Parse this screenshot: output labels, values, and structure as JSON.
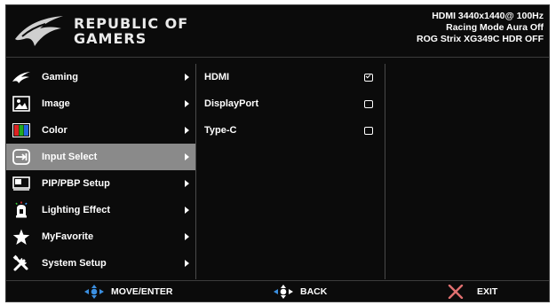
{
  "brand": {
    "line1": "REPUBLIC OF",
    "line2": "GAMERS"
  },
  "status": {
    "line1": "HDMI  3440x1440@  100Hz",
    "line2": "Racing Mode    Aura Off",
    "line3": "ROG Strix XG349C   HDR OFF"
  },
  "menu": [
    {
      "label": "Gaming",
      "icon": "gaming-icon"
    },
    {
      "label": "Image",
      "icon": "image-icon"
    },
    {
      "label": "Color",
      "icon": "color-icon"
    },
    {
      "label": "Input Select",
      "icon": "input-select-icon",
      "selected": true
    },
    {
      "label": "PIP/PBP Setup",
      "icon": "pip-pbp-icon"
    },
    {
      "label": "Lighting Effect",
      "icon": "lighting-effect-icon"
    },
    {
      "label": "MyFavorite",
      "icon": "star-icon"
    },
    {
      "label": "System Setup",
      "icon": "system-setup-icon"
    }
  ],
  "submenu": [
    {
      "label": "HDMI",
      "checked": true
    },
    {
      "label": "DisplayPort",
      "checked": false
    },
    {
      "label": "Type-C",
      "checked": false
    }
  ],
  "footer": {
    "move": "MOVE/ENTER",
    "back": "BACK",
    "exit": "EXIT"
  },
  "colors": {
    "selected_bg": "#8a8a8a",
    "background": "#0b0b0b"
  }
}
